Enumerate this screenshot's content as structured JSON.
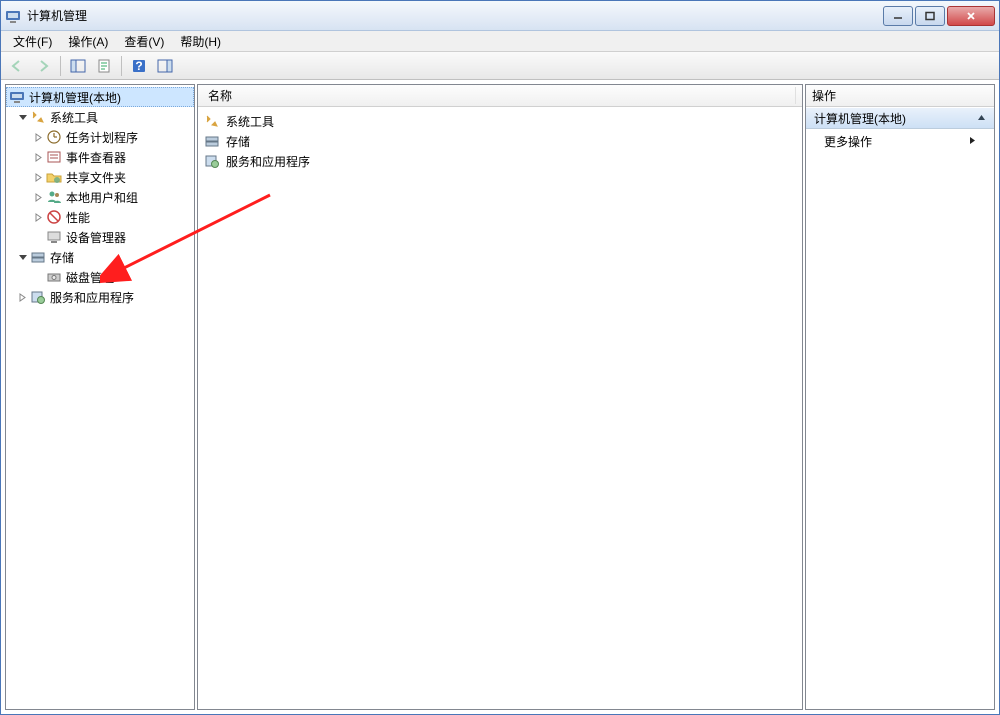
{
  "title": "计算机管理",
  "menu": {
    "file": "文件(F)",
    "action": "操作(A)",
    "view": "查看(V)",
    "help": "帮助(H)"
  },
  "tree": {
    "root": "计算机管理(本地)",
    "system_tools": "系统工具",
    "task_scheduler": "任务计划程序",
    "event_viewer": "事件查看器",
    "shared_folders": "共享文件夹",
    "local_users": "本地用户和组",
    "performance": "性能",
    "device_manager": "设备管理器",
    "storage": "存储",
    "disk_management": "磁盘管理",
    "services_apps": "服务和应用程序"
  },
  "list": {
    "header_name": "名称",
    "items": [
      {
        "label": "系统工具"
      },
      {
        "label": "存储"
      },
      {
        "label": "服务和应用程序"
      }
    ]
  },
  "actions": {
    "header": "操作",
    "group_title": "计算机管理(本地)",
    "more_actions": "更多操作"
  }
}
